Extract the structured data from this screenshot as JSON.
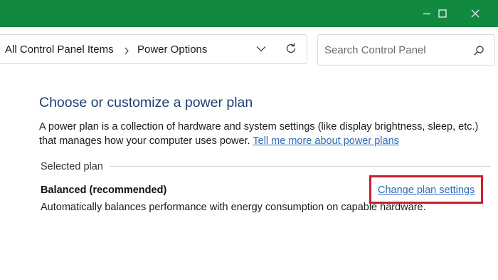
{
  "window": {
    "title_bar_color": "#118a3f",
    "controls": {
      "minimize_icon": "minimize-icon",
      "maximize_icon": "maximize-icon",
      "close_icon": "close-icon"
    }
  },
  "address_bar": {
    "breadcrumbs": [
      {
        "label": "All Control Panel Items"
      },
      {
        "label": "Power Options"
      }
    ],
    "separator_icon": "chevron-right-icon",
    "dropdown_icon": "chevron-down-icon",
    "refresh_icon": "refresh-icon"
  },
  "search": {
    "placeholder": "Search Control Panel",
    "value": "",
    "icon": "search-icon"
  },
  "main": {
    "title": "Choose or customize a power plan",
    "description_line1": "A power plan is a collection of hardware and system settings (like display brightness, sleep, etc.)",
    "description_line2_prefix": "that manages how your computer uses power. ",
    "learn_more_link": "Tell me more about power plans",
    "section_label": "Selected plan",
    "plan": {
      "name": "Balanced (recommended)",
      "description": "Automatically balances performance with energy consumption on capable hardware.",
      "change_settings_link": "Change plan settings"
    }
  },
  "colors": {
    "heading": "#1e3f73",
    "link": "#2a6ab8",
    "highlight_box": "#c8202a"
  }
}
